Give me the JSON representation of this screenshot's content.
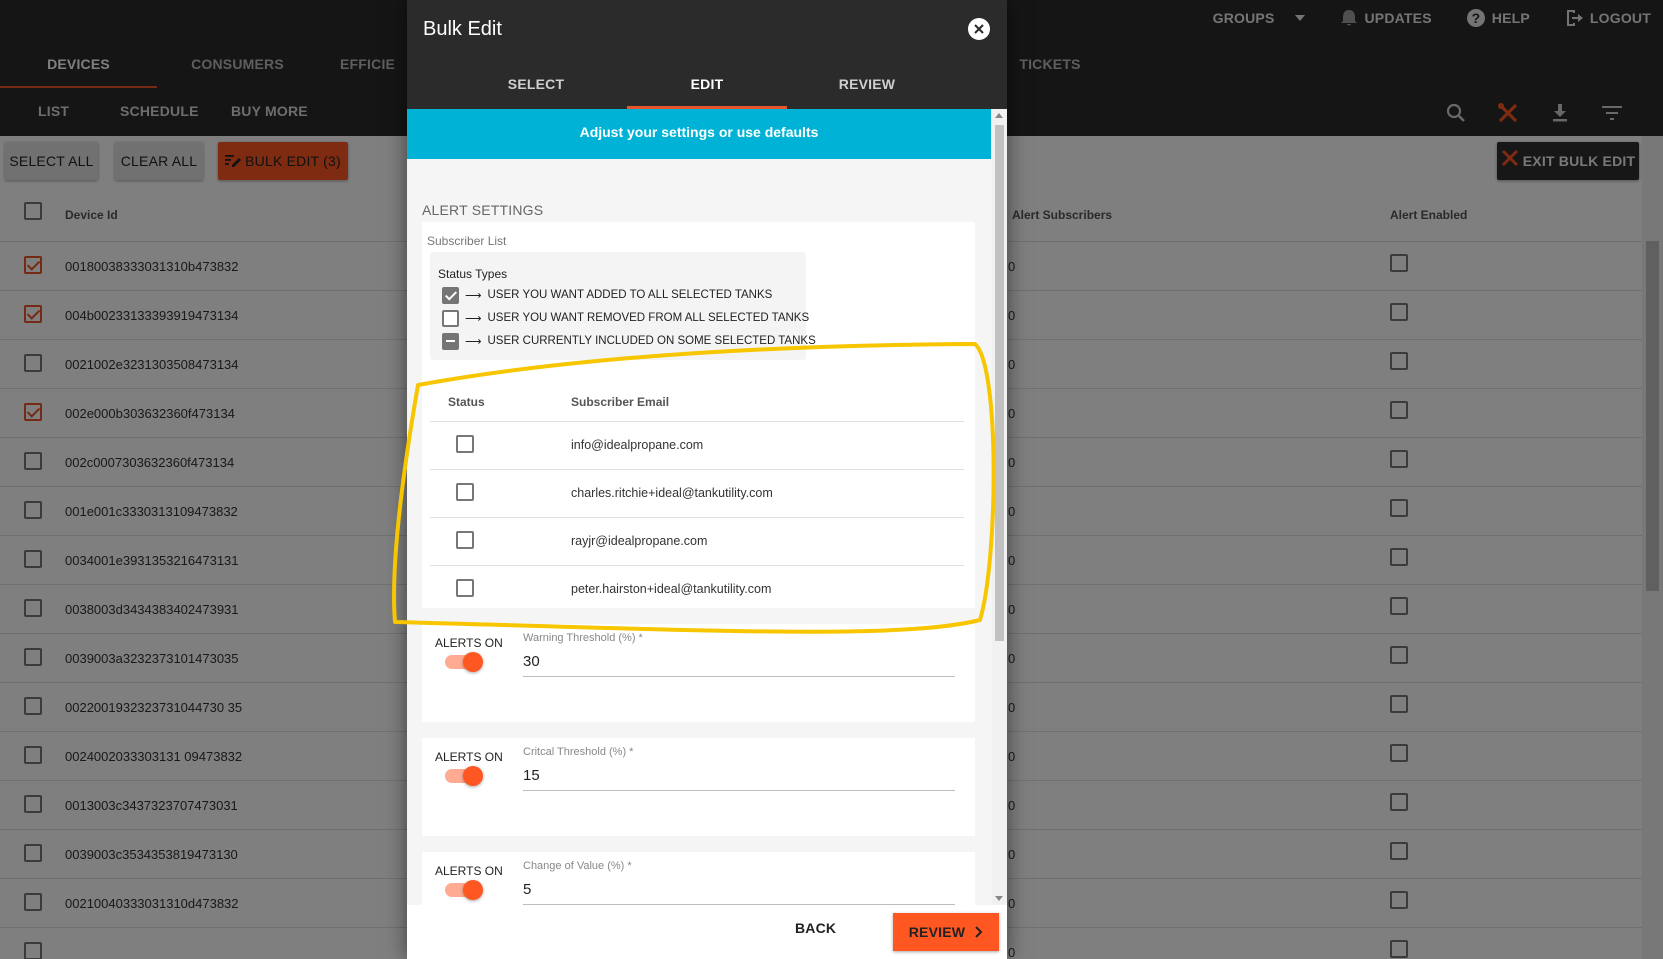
{
  "topnav": {
    "groups": "GROUPS",
    "updates": "UPDATES",
    "help": "HELP",
    "logout": "LOGOUT"
  },
  "tabs": [
    "DEVICES",
    "CONSUMERS",
    "EFFICIE",
    "TICKETS"
  ],
  "subtabs": [
    "LIST",
    "SCHEDULE",
    "BUY MORE"
  ],
  "toolbar": {
    "select_all": "SELECT ALL",
    "clear_all": "CLEAR ALL",
    "bulk_edit": "BULK EDIT (3)",
    "exit_bulk_edit": "EXIT BULK EDIT"
  },
  "grid": {
    "headers": {
      "device_id": "Device Id",
      "alert_subscribers": "Alert Subscribers",
      "alert_enabled": "Alert Enabled"
    },
    "rows": [
      {
        "id": "00180038333031310b473832",
        "checked": true,
        "subscribers": "0"
      },
      {
        "id": "004b00233133393919473134",
        "checked": true,
        "subscribers": "0"
      },
      {
        "id": "0021002e3231303508473134",
        "checked": false,
        "subscribers": "0"
      },
      {
        "id": "002e000b303632360f473134",
        "checked": true,
        "subscribers": "0"
      },
      {
        "id": "002c0007303632360f473134",
        "checked": false,
        "subscribers": "0"
      },
      {
        "id": "001e001c3330313109473832",
        "checked": false,
        "subscribers": "0"
      },
      {
        "id": "0034001e3931353216473131",
        "checked": false,
        "subscribers": "0"
      },
      {
        "id": "0038003d3434383402473931",
        "checked": false,
        "subscribers": "0"
      },
      {
        "id": "0039003a3232373101473035",
        "checked": false,
        "subscribers": "0"
      },
      {
        "id": "0022001932323731044730 35",
        "checked": false,
        "subscribers": "0"
      },
      {
        "id": "0024002033303131 09473832",
        "checked": false,
        "subscribers": "0"
      },
      {
        "id": "0013003c3437323707473031",
        "checked": false,
        "subscribers": "0"
      },
      {
        "id": "0039003c3534353819473130",
        "checked": false,
        "subscribers": "0"
      },
      {
        "id": "00210040333031310d473832",
        "checked": false,
        "subscribers": "0"
      },
      {
        "id": "",
        "checked": false,
        "subscribers": "0"
      }
    ]
  },
  "modal": {
    "title": "Bulk Edit",
    "tabs": [
      "SELECT",
      "EDIT",
      "REVIEW"
    ],
    "banner": "Adjust your settings or use defaults",
    "section": "ALERT SETTINGS",
    "subscriber_list": "Subscriber List",
    "status_types_title": "Status Types",
    "status_types": [
      {
        "state": "checked",
        "text": "USER YOU WANT ADDED TO ALL SELECTED TANKS"
      },
      {
        "state": "unchecked",
        "text": "USER YOU WANT REMOVED FROM ALL SELECTED TANKS"
      },
      {
        "state": "indeterminate",
        "text": "USER CURRENTLY INCLUDED ON SOME SELECTED TANKS"
      }
    ],
    "table_headers": {
      "status": "Status",
      "email": "Subscriber Email"
    },
    "subscribers": [
      "info@idealpropane.com",
      "charles.ritchie+ideal@tankutility.com",
      "rayjr@idealpropane.com",
      "peter.hairston+ideal@tankutility.com"
    ],
    "alerts": [
      {
        "toggle_label": "ALERTS ON",
        "field_label": "Warning Threshold (%) *",
        "value": "30"
      },
      {
        "toggle_label": "ALERTS ON",
        "field_label": "Critcal Threshold (%) *",
        "value": "15"
      },
      {
        "toggle_label": "ALERTS ON",
        "field_label": "Change of Value (%) *",
        "value": "5"
      }
    ],
    "back": "BACK",
    "review": "REVIEW"
  },
  "colors": {
    "accent": "#ff5722",
    "banner": "#00b3d6",
    "header": "#2b2b2b",
    "highlight": "#f7c600"
  },
  "icons": [
    "chevron-down-icon",
    "bell-icon",
    "help-icon",
    "logout-icon",
    "search-icon",
    "tools-icon",
    "download-icon",
    "filter-icon",
    "close-icon",
    "chevron-right-icon"
  ]
}
